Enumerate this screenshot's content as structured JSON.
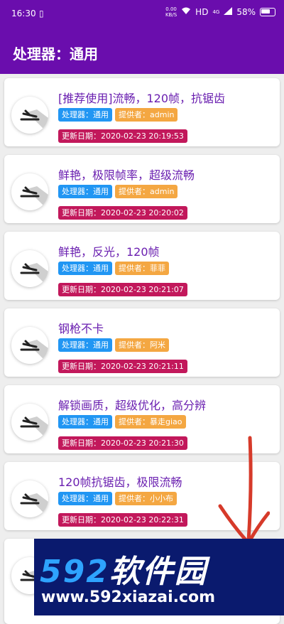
{
  "status_bar": {
    "time": "16:30",
    "vibrate_icon": "vibrate-icon",
    "net_speed_value": "0.00",
    "net_speed_unit": "KB/S",
    "hd": "HD",
    "network": "4G",
    "battery": "58%"
  },
  "appbar": {
    "title": "处理器：通用"
  },
  "items": [
    {
      "title": "[推荐使用]流畅，120帧，抗锯齿",
      "processor": "处理器：通用",
      "provider": "提供者：admin",
      "date": "更新日期：2020-02-23 20:19:53"
    },
    {
      "title": "鲜艳，极限帧率，超级流畅",
      "processor": "处理器：通用",
      "provider": "提供者：admin",
      "date": "更新日期：2020-02-23 20:20:02"
    },
    {
      "title": "鲜艳，反光，120帧",
      "processor": "处理器：通用",
      "provider": "提供者：菲菲",
      "date": "更新日期：2020-02-23 20:21:07"
    },
    {
      "title": "钢枪不卡",
      "processor": "处理器：通用",
      "provider": "提供者：阿米",
      "date": "更新日期：2020-02-23 20:21:11"
    },
    {
      "title": "解锁画质，超级优化，高分辨",
      "processor": "处理器：通用",
      "provider": "提供者：暴走giao",
      "date": "更新日期：2020-02-23 20:21:30"
    },
    {
      "title": "120帧抗锯齿，极限流畅",
      "processor": "处理器：通用",
      "provider": "提供者：小小布",
      "date": "更新日期：2020-02-23 20:22:31"
    }
  ],
  "watermark": {
    "brand_num": "592",
    "brand_cn": "软件园",
    "url": "www.592xiazai.com"
  },
  "colors": {
    "primary": "#6a0dad",
    "processor_tag": "#2196f3",
    "provider_tag": "#f4a742",
    "date_tag": "#c2185b",
    "arrow": "#d63a2a"
  }
}
